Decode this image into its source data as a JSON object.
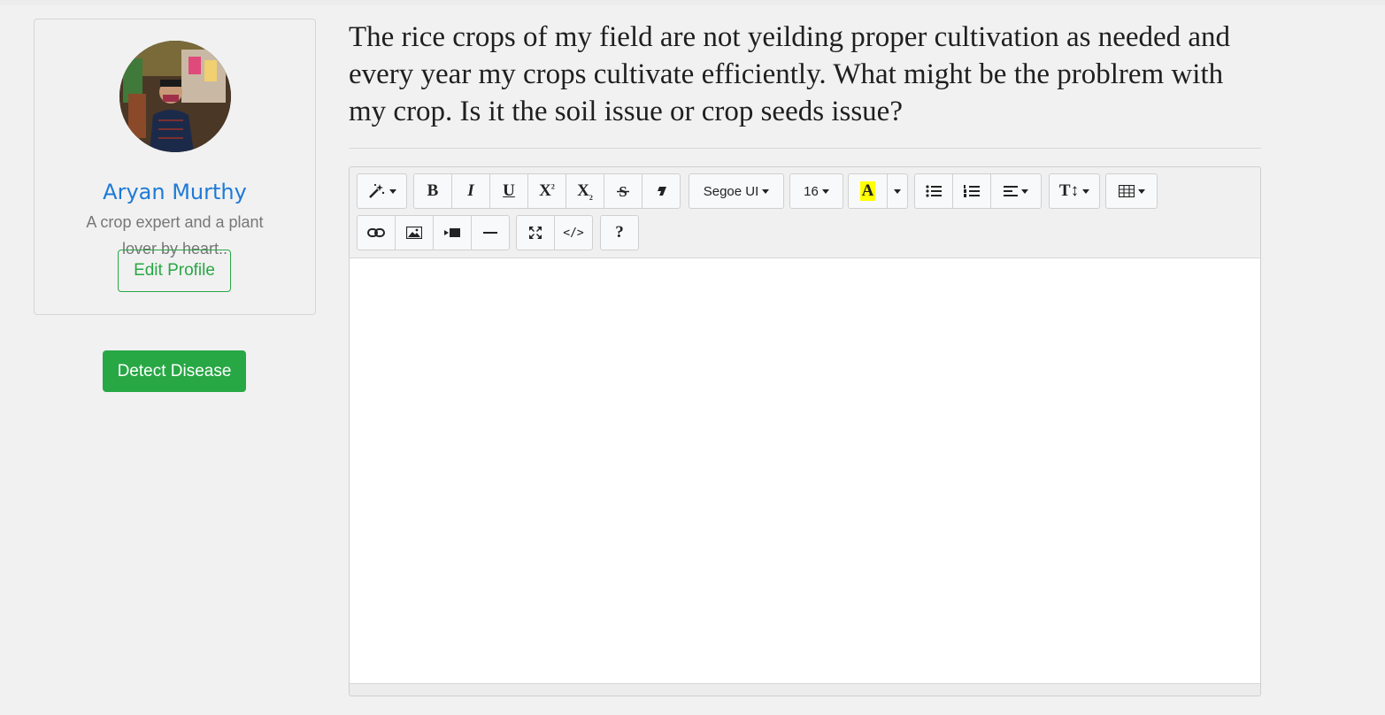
{
  "profile": {
    "name": "Aryan Murthy",
    "bio": "A crop expert and a plant lover by heart..",
    "edit_label": "Edit Profile"
  },
  "actions": {
    "detect_label": "Detect Disease"
  },
  "question": {
    "text": "The rice crops of my field are not yeilding proper cultivation as needed and every year my crops cultivate efficiently. What might be the problrem with my crop. Is it the soil issue or crop seeds issue?"
  },
  "editor": {
    "toolbar": {
      "font_family": "Segoe UI",
      "font_size": "16",
      "bold": "B",
      "italic": "I",
      "underline": "U",
      "superscript": "X",
      "subscript": "X",
      "color": "A",
      "help": "?",
      "line_height": "T"
    },
    "content": ""
  },
  "colors": {
    "accent_blue": "#1e7ad6",
    "success_green": "#28a745",
    "highlight_yellow": "#ffff00"
  }
}
